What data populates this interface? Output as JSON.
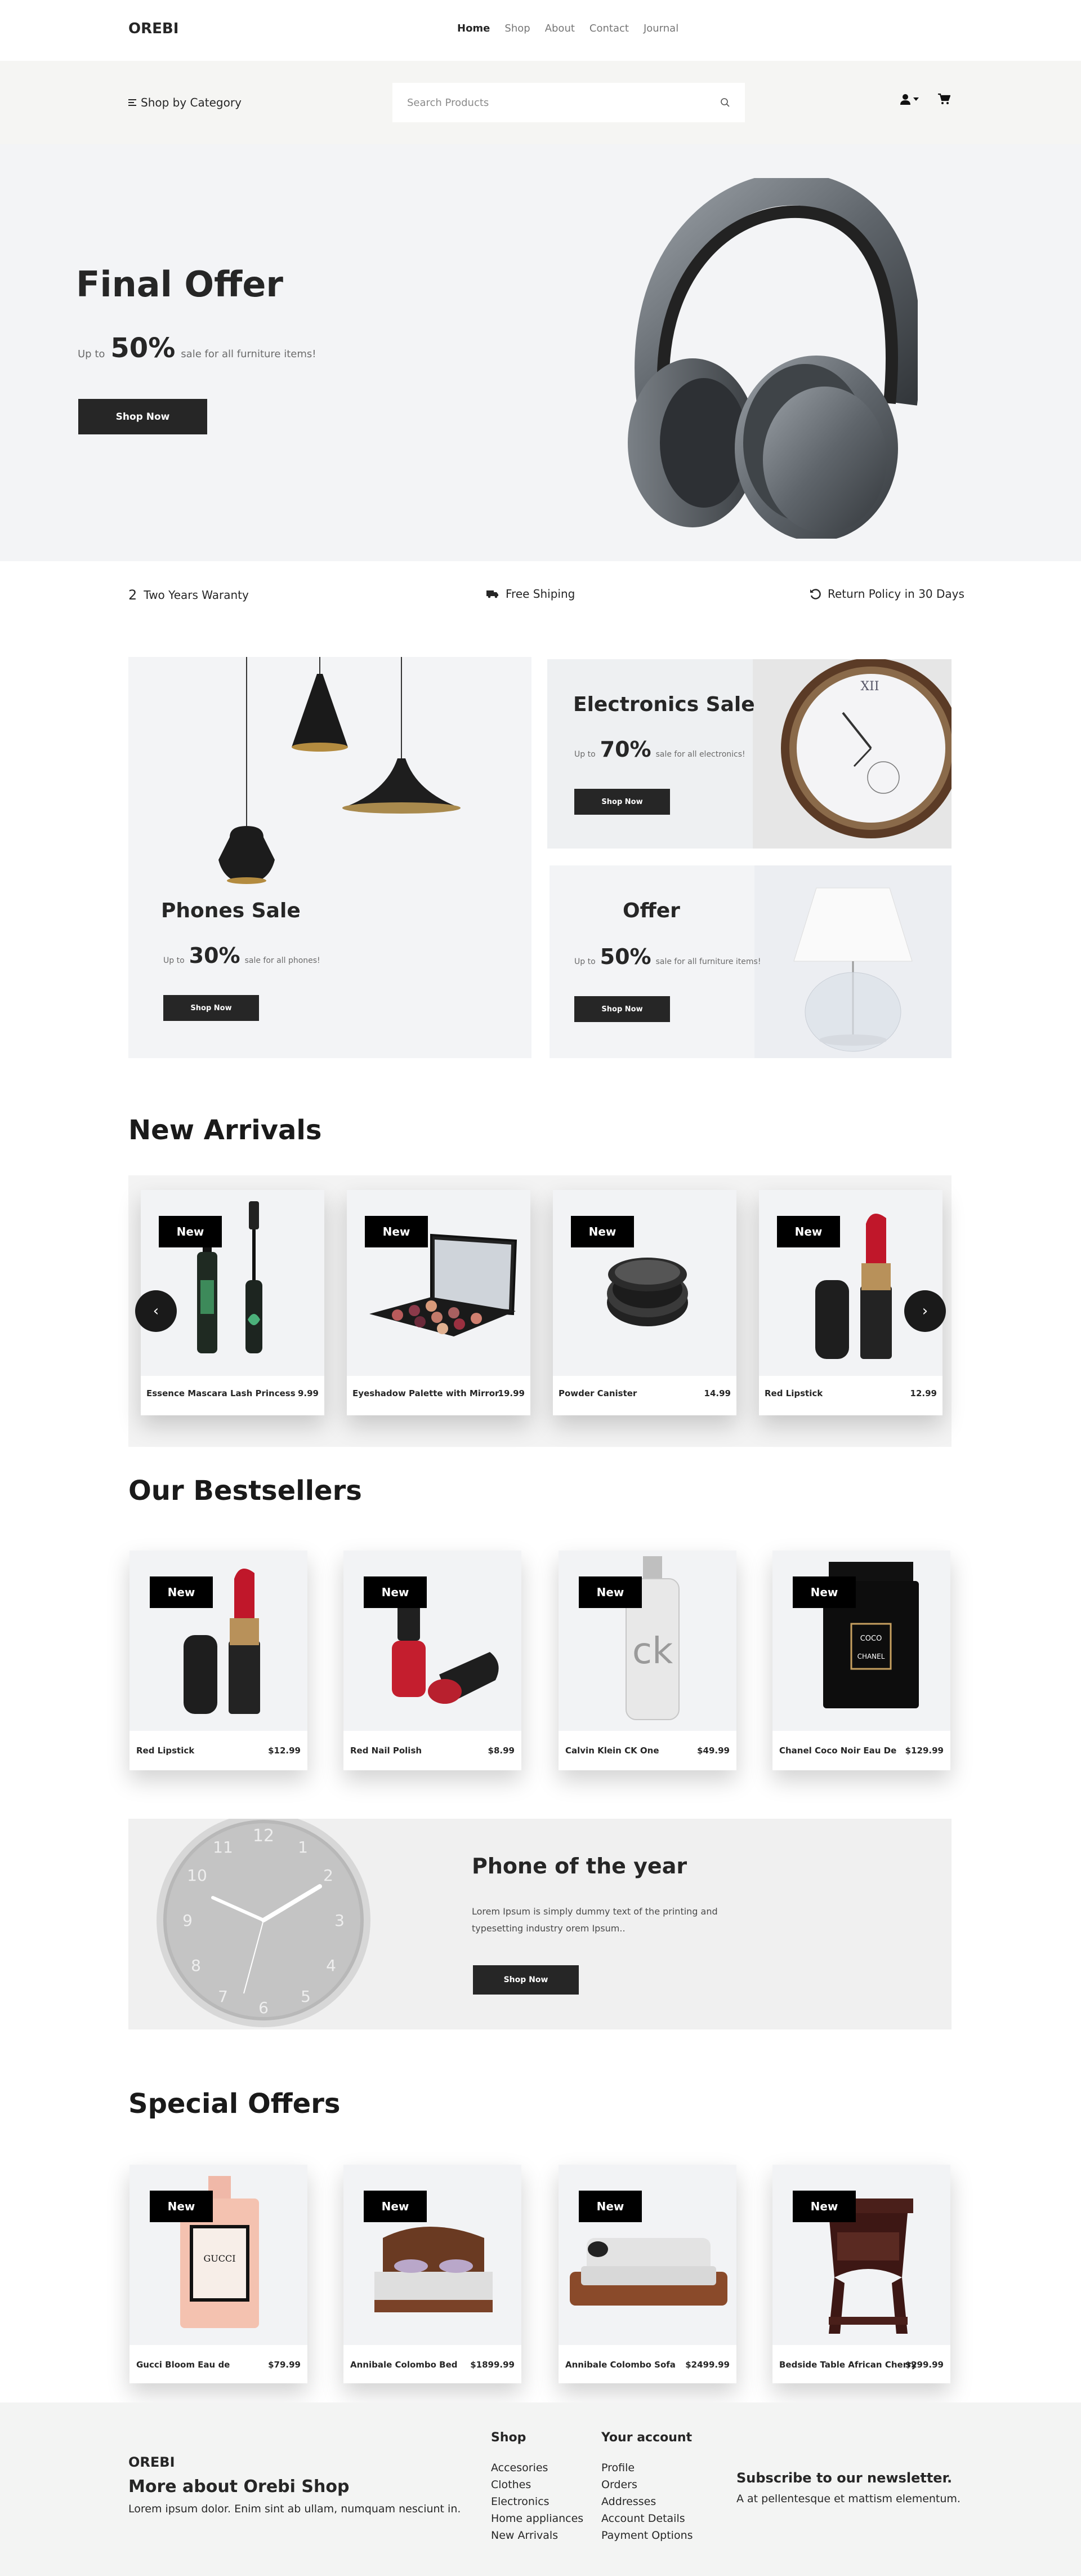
{
  "header": {
    "logo": "OREBI",
    "nav": [
      "Home",
      "Shop",
      "About",
      "Contact",
      "Journal"
    ]
  },
  "catbar": {
    "category": "Shop by Category",
    "search_placeholder": "Search Products"
  },
  "hero": {
    "title": "Final Offer",
    "up_to": "Up to",
    "percent": "50%",
    "sale_text": "sale for all furniture items!",
    "button": "Shop Now"
  },
  "features": [
    "Two Years Waranty",
    "Free Shiping",
    "Return Policy in 30 Days"
  ],
  "features_number": "2",
  "promos": {
    "phones": {
      "title": "Phones Sale",
      "up_to": "Up to",
      "percent": "30%",
      "text": "sale for all phones!",
      "button": "Shop Now"
    },
    "electronics": {
      "title": "Electronics Sale",
      "up_to": "Up to",
      "percent": "70%",
      "text": "sale for all electronics!",
      "button": "Shop Now"
    },
    "offer": {
      "title": "Offer",
      "up_to": "Up to",
      "percent": "50%",
      "text": "sale for all furniture items!",
      "button": "Shop Now"
    }
  },
  "new_arrivals": {
    "title": "New Arrivals",
    "badge": "New",
    "items": [
      {
        "name": "Essence Mascara Lash Princess",
        "price": "9.99"
      },
      {
        "name": "Eyeshadow Palette with Mirror",
        "price": "19.99"
      },
      {
        "name": "Powder Canister",
        "price": "14.99"
      },
      {
        "name": "Red Lipstick",
        "price": "12.99"
      }
    ]
  },
  "bestsellers": {
    "title": "Our Bestsellers",
    "badge": "New",
    "items": [
      {
        "name": "Red Lipstick",
        "price": "$12.99"
      },
      {
        "name": "Red Nail Polish",
        "price": "$8.99"
      },
      {
        "name": "Calvin Klein CK One",
        "price": "$49.99"
      },
      {
        "name": "Chanel Coco Noir Eau De",
        "price": "$129.99"
      }
    ]
  },
  "year": {
    "title": "Phone of the year",
    "text": "Lorem Ipsum is simply dummy text of the printing and typesetting industry orem Ipsum..",
    "button": "Shop Now"
  },
  "special": {
    "title": "Special Offers",
    "badge": "New",
    "items": [
      {
        "name": "Gucci Bloom Eau de",
        "price": "$79.99"
      },
      {
        "name": "Annibale Colombo Bed",
        "price": "$1899.99"
      },
      {
        "name": "Annibale Colombo Sofa",
        "price": "$2499.99"
      },
      {
        "name": "Bedside Table African Cherry",
        "price": "$299.99"
      }
    ]
  },
  "footer": {
    "logo": "OREBI",
    "about_title": "More about Orebi Shop",
    "about_text": "Lorem ipsum dolor. Enim sint ab ullam, numquam nesciunt in.",
    "shop_title": "Shop",
    "shop_links": [
      "Accesories",
      "Clothes",
      "Electronics",
      "Home appliances",
      "New Arrivals"
    ],
    "account_title": "Your account",
    "account_links": [
      "Profile",
      "Orders",
      "Addresses",
      "Account Details",
      "Payment Options"
    ],
    "news_title": "Subscribe to our newsletter.",
    "news_text": "A at pellentesque et mattism elementum."
  },
  "colors": {
    "dark": "#262626",
    "panel": "#f3f4f6",
    "bar": "#f5f5f3"
  }
}
